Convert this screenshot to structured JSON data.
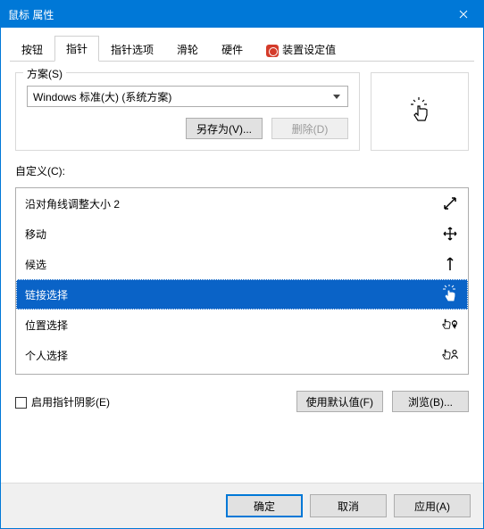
{
  "window": {
    "title": "鼠标 属性"
  },
  "tabs": [
    {
      "label": "按钮"
    },
    {
      "label": "指针"
    },
    {
      "label": "指针选项"
    },
    {
      "label": "滑轮"
    },
    {
      "label": "硬件"
    },
    {
      "label": "装置设定值"
    }
  ],
  "active_tab": 1,
  "scheme": {
    "legend": "方案(S)",
    "selected": "Windows 标准(大) (系统方案)",
    "save_as": "另存为(V)...",
    "delete": "删除(D)"
  },
  "customize_label": "自定义(C):",
  "cursors": [
    {
      "label": "沿对角线调整大小 2",
      "icon": "resize-diag2"
    },
    {
      "label": "移动",
      "icon": "move"
    },
    {
      "label": "候选",
      "icon": "alt"
    },
    {
      "label": "链接选择",
      "icon": "link-hand",
      "selected": true
    },
    {
      "label": "位置选择",
      "icon": "location"
    },
    {
      "label": "个人选择",
      "icon": "person"
    }
  ],
  "preview_icon": "link-hand",
  "shadow": {
    "label": "启用指针阴影(E)",
    "checked": false
  },
  "use_default": "使用默认值(F)",
  "browse": "浏览(B)...",
  "footer": {
    "ok": "确定",
    "cancel": "取消",
    "apply": "应用(A)"
  }
}
